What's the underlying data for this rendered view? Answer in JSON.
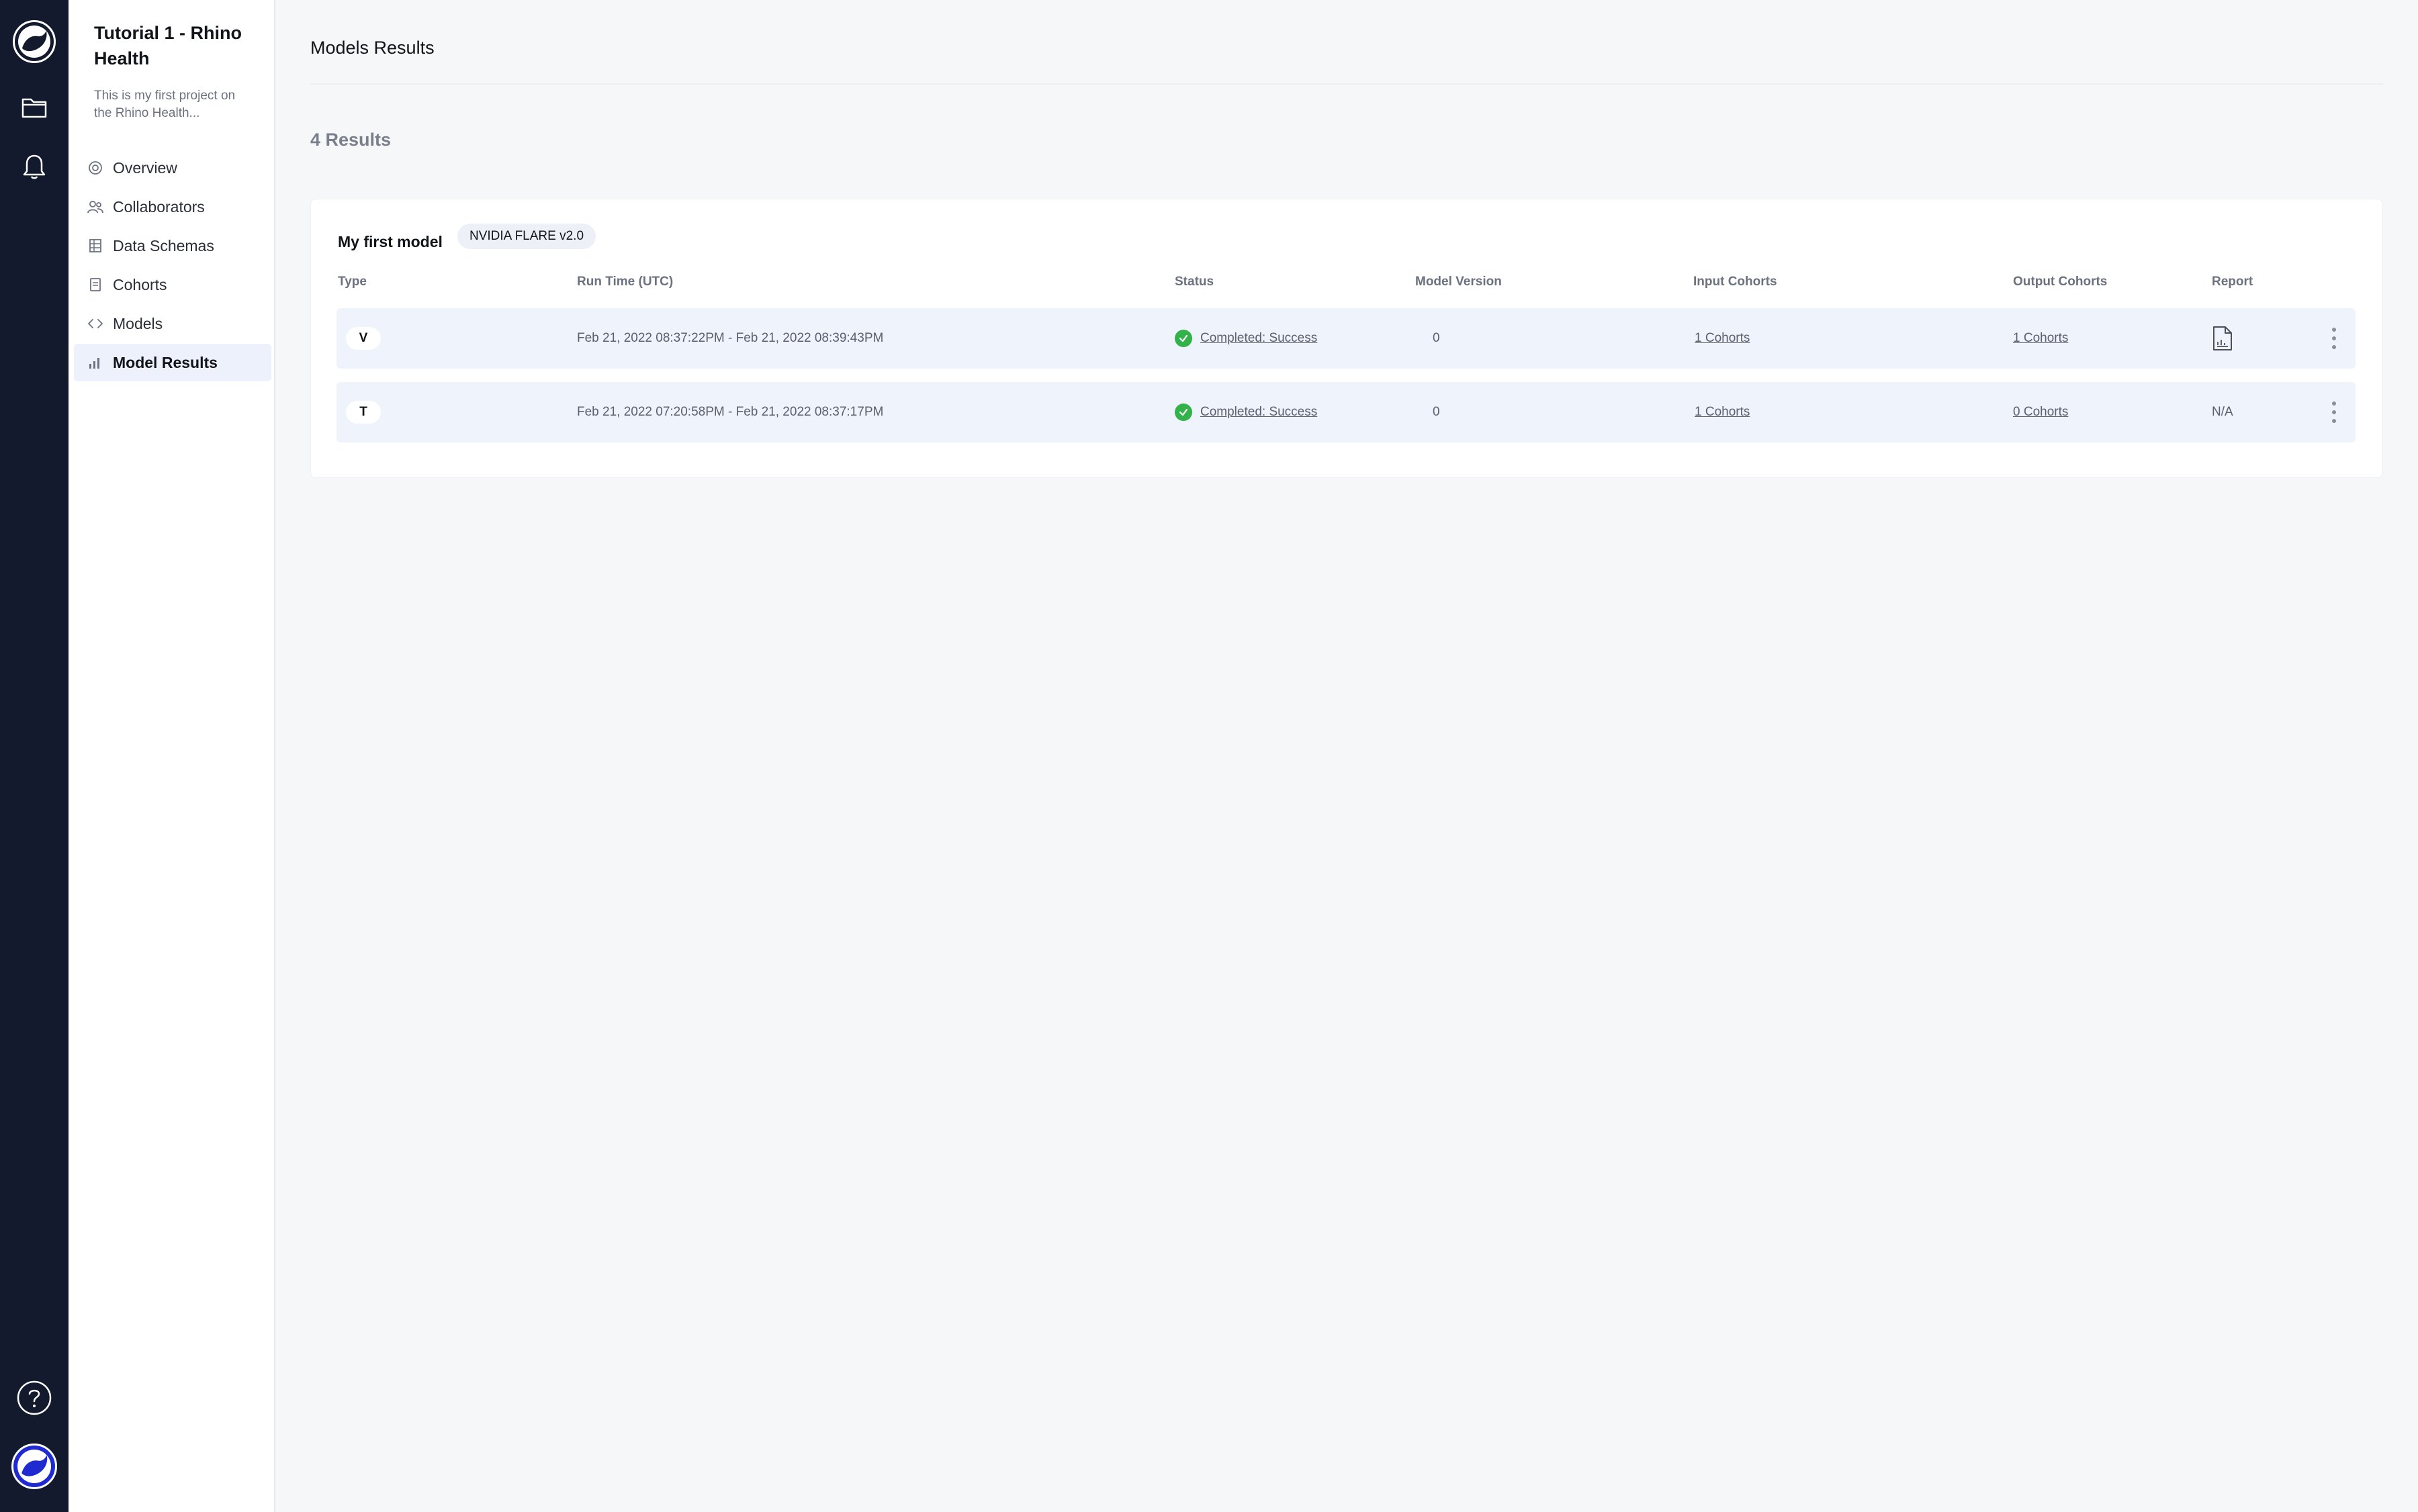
{
  "rail": {
    "icons": [
      "logo-icon",
      "folder-icon",
      "bell-icon",
      "help-icon",
      "avatar"
    ]
  },
  "project": {
    "title": "Tutorial 1 - Rhino Health",
    "description": "This is my first project on the Rhino Health..."
  },
  "sidebar": {
    "items": [
      {
        "label": "Overview",
        "icon": "overview-icon"
      },
      {
        "label": "Collaborators",
        "icon": "collaborators-icon"
      },
      {
        "label": "Data Schemas",
        "icon": "data-schemas-icon"
      },
      {
        "label": "Cohorts",
        "icon": "cohorts-icon"
      },
      {
        "label": "Models",
        "icon": "code-icon"
      },
      {
        "label": "Model Results",
        "icon": "bar-chart-icon",
        "active": true
      }
    ]
  },
  "main": {
    "title": "Models Results",
    "results_count": "4 Results",
    "card": {
      "model_name": "My first model",
      "badge": "NVIDIA FLARE v2.0",
      "columns": [
        "Type",
        "Run Time (UTC)",
        "Status",
        "Model Version",
        "Input Cohorts",
        "Output Cohorts",
        "Report"
      ],
      "rows": [
        {
          "type": "V",
          "run_time": "Feb 21, 2022 08:37:22PM - Feb 21, 2022 08:39:43PM",
          "status": "Completed: Success",
          "model_version": "0",
          "input_cohorts": "1 Cohorts",
          "output_cohorts": "1 Cohorts",
          "report": "report-file-icon"
        },
        {
          "type": "T",
          "run_time": "Feb 21, 2022 07:20:58PM - Feb 21, 2022 08:37:17PM",
          "status": "Completed: Success",
          "model_version": "0",
          "input_cohorts": "1 Cohorts",
          "output_cohorts": "0 Cohorts",
          "report": "N/A"
        }
      ]
    }
  },
  "colors": {
    "rail_bg": "#131a2e",
    "active_nav_bg": "#edf1fb",
    "row_bg": "#eef3fc",
    "success": "#33b24a"
  }
}
